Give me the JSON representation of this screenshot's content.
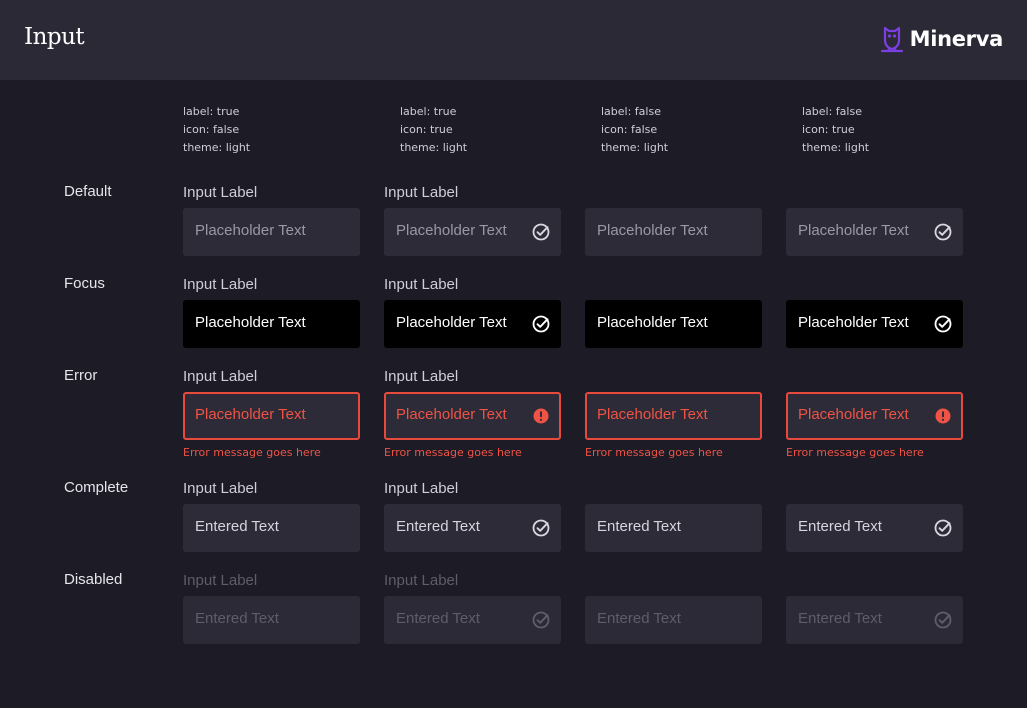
{
  "header": {
    "title": "Input",
    "brand": "Minerva"
  },
  "columns": [
    {
      "props": [
        "label: true",
        "icon: false",
        "theme: light"
      ],
      "label": true,
      "icon": false
    },
    {
      "props": [
        "label: true",
        "icon: true",
        "theme: light"
      ],
      "label": true,
      "icon": true
    },
    {
      "props": [
        "label: false",
        "icon: false",
        "theme: light"
      ],
      "label": false,
      "icon": false
    },
    {
      "props": [
        "label: false",
        "icon: true",
        "theme: light"
      ],
      "label": false,
      "icon": true
    }
  ],
  "rows": [
    {
      "name": "Default",
      "label_text": "Input Label",
      "value": "Placeholder Text"
    },
    {
      "name": "Focus",
      "label_text": "Input Label",
      "value": "Placeholder Text"
    },
    {
      "name": "Error",
      "label_text": "Input Label",
      "value": "Placeholder Text",
      "error": "Error message goes here"
    },
    {
      "name": "Complete",
      "label_text": "Input Label",
      "value": "Entered Text"
    },
    {
      "name": "Disabled",
      "label_text": "Input Label",
      "value": "Entered Text"
    }
  ],
  "colors": {
    "error": "#ef5346",
    "brand": "#7b3fe4",
    "background": "#1c1b26",
    "header": "#2a2935"
  }
}
